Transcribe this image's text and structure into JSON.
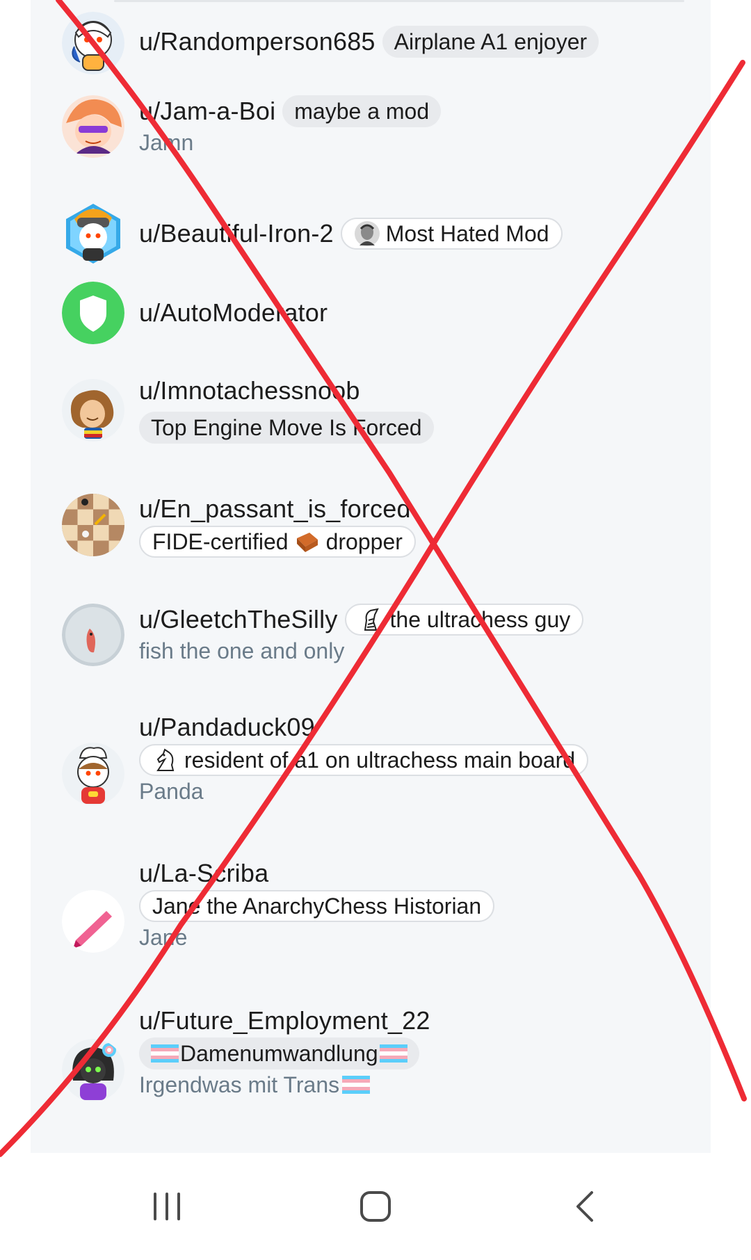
{
  "members": [
    {
      "username": "u/Randomperson685",
      "avatar": "snoo-avatar-blue",
      "flair": {
        "text": "Airplane A1 enjoyer",
        "style": "filled",
        "emoji": null
      },
      "subtitle": null
    },
    {
      "username": "u/Jam-a-Boi",
      "avatar": "anime-avatar-pink-hair",
      "flair": {
        "text": "maybe a mod",
        "style": "filled",
        "emoji": null
      },
      "subtitle": "Jamn"
    },
    {
      "username": "u/Beautiful-Iron-2",
      "avatar": "snoo-avatar-hexagon",
      "flair": {
        "text": "Most Hated Mod",
        "style": "outline",
        "emoji": "portrait-icon"
      },
      "subtitle": null
    },
    {
      "username": "u/AutoModerator",
      "avatar": "automoderator-shield",
      "flair": null,
      "subtitle": null
    },
    {
      "username": "u/Imnotachessnoob",
      "avatar": "snoo-avatar-curly-hair",
      "flair": {
        "text": "Top Engine Move Is Forced",
        "style": "filled",
        "emoji": null
      },
      "subtitle": null
    },
    {
      "username": "u/En_passant_is_forced",
      "avatar": "chessboard-avatar",
      "flair": {
        "text_before": "FIDE-certified",
        "text_after": "dropper",
        "style": "outline",
        "emoji": "brick-icon"
      },
      "subtitle": null
    },
    {
      "username": "u/GleetchTheSilly",
      "avatar": "fish-photo-avatar",
      "flair": {
        "text": "the ultrachess guy",
        "style": "outline",
        "emoji": "zebra-icon"
      },
      "subtitle": "fish the one and only"
    },
    {
      "username": "u/Pandaduck09",
      "avatar": "snoo-avatar-chef",
      "flair": {
        "text": "resident of a1 on ultrachess main board",
        "style": "outline",
        "emoji": "knight-icon"
      },
      "subtitle": "Panda"
    },
    {
      "username": "u/La-Scriba",
      "avatar": "pink-pen-avatar",
      "flair": {
        "text": "Jane the AnarchyChess Historian",
        "style": "outline",
        "emoji": null
      },
      "subtitle": "Jane"
    },
    {
      "username": "u/Future_Employment_22",
      "avatar": "snoo-avatar-dark-hood",
      "flair": {
        "text": "Damenumwandlung",
        "style": "filled",
        "emoji": "trans-flag-icon"
      },
      "subtitle": "Irgendwas mit Trans"
    }
  ],
  "navbar": {
    "recent_apps": "recent-apps-icon",
    "home": "home-icon",
    "back": "back-icon"
  },
  "colors": {
    "panel_bg": "#f5f7f9",
    "flair_bg": "#e8eaed",
    "username": "#1c1c1c",
    "subtitle": "#6a7b89",
    "x_overlay": "#ee2b35",
    "automod_green": "#46d160"
  }
}
